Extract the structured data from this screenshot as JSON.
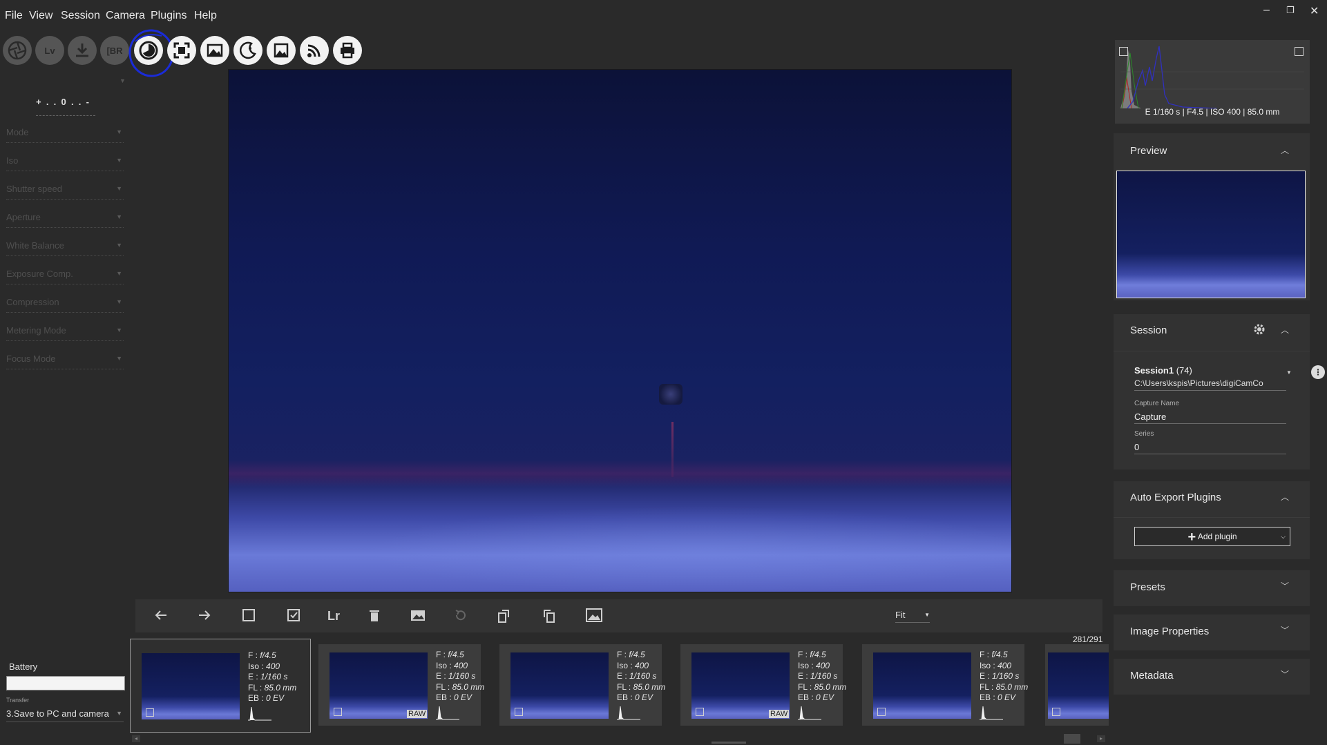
{
  "menu": [
    "File",
    "View",
    "Session",
    "Camera",
    "Plugins",
    "Help"
  ],
  "window_controls": {
    "minimize": "–",
    "restore": "❐",
    "close": "✕"
  },
  "toolbar": {
    "lv_label": "Lv",
    "br_label": "[BR"
  },
  "left_panel": {
    "exposure_scale": "+  .  .  0  .  .  -",
    "controls": [
      "Mode",
      "Iso",
      "Shutter speed",
      "Aperture",
      "White Balance",
      "Exposure Comp.",
      "Compression",
      "Metering Mode",
      "Focus Mode"
    ],
    "battery_label": "Battery",
    "transfer_label": "Transfer",
    "transfer_value": "3.Save to PC and camera"
  },
  "image_toolbar": {
    "lr_label": "Lr",
    "zoom_value": "Fit",
    "counter": "281/291"
  },
  "thumbnails": [
    {
      "f": "f/4.5",
      "iso": "400",
      "e": "1/160 s",
      "fl": "85.0 mm",
      "eb": "0 EV",
      "raw": false,
      "selected": true
    },
    {
      "f": "f/4.5",
      "iso": "400",
      "e": "1/160 s",
      "fl": "85.0 mm",
      "eb": "0 EV",
      "raw": true,
      "selected": false
    },
    {
      "f": "f/4.5",
      "iso": "400",
      "e": "1/160 s",
      "fl": "85.0 mm",
      "eb": "0 EV",
      "raw": false,
      "selected": false
    },
    {
      "f": "f/4.5",
      "iso": "400",
      "e": "1/160 s",
      "fl": "85.0 mm",
      "eb": "0 EV",
      "raw": true,
      "selected": false
    },
    {
      "f": "f/4.5",
      "iso": "400",
      "e": "1/160 s",
      "fl": "85.0 mm",
      "eb": "0 EV",
      "raw": false,
      "selected": false
    }
  ],
  "thumb_labels": {
    "f": "F : ",
    "iso": "Iso : ",
    "e": "E : ",
    "fl": "FL : ",
    "eb": "EB : ",
    "raw": "RAW"
  },
  "histogram": {
    "info": "E 1/160 s | F4.5 | ISO 400 | 85.0 mm"
  },
  "preview": {
    "title": "Preview"
  },
  "session": {
    "title": "Session",
    "name": "Session1",
    "count": "(74)",
    "path": "C:\\Users\\kspis\\Pictures\\digiCamCo",
    "capture_name_label": "Capture Name",
    "capture_name": "Capture",
    "series_label": "Series",
    "series": "0"
  },
  "auto_export": {
    "title": "Auto Export Plugins",
    "add_label": "Add plugin"
  },
  "presets": {
    "title": "Presets"
  },
  "image_properties": {
    "title": "Image Properties"
  },
  "metadata": {
    "title": "Metadata"
  },
  "colors": {
    "bg": "#2a2a2a",
    "panel": "#323232",
    "highlight_ring": "#1a2bd8"
  }
}
